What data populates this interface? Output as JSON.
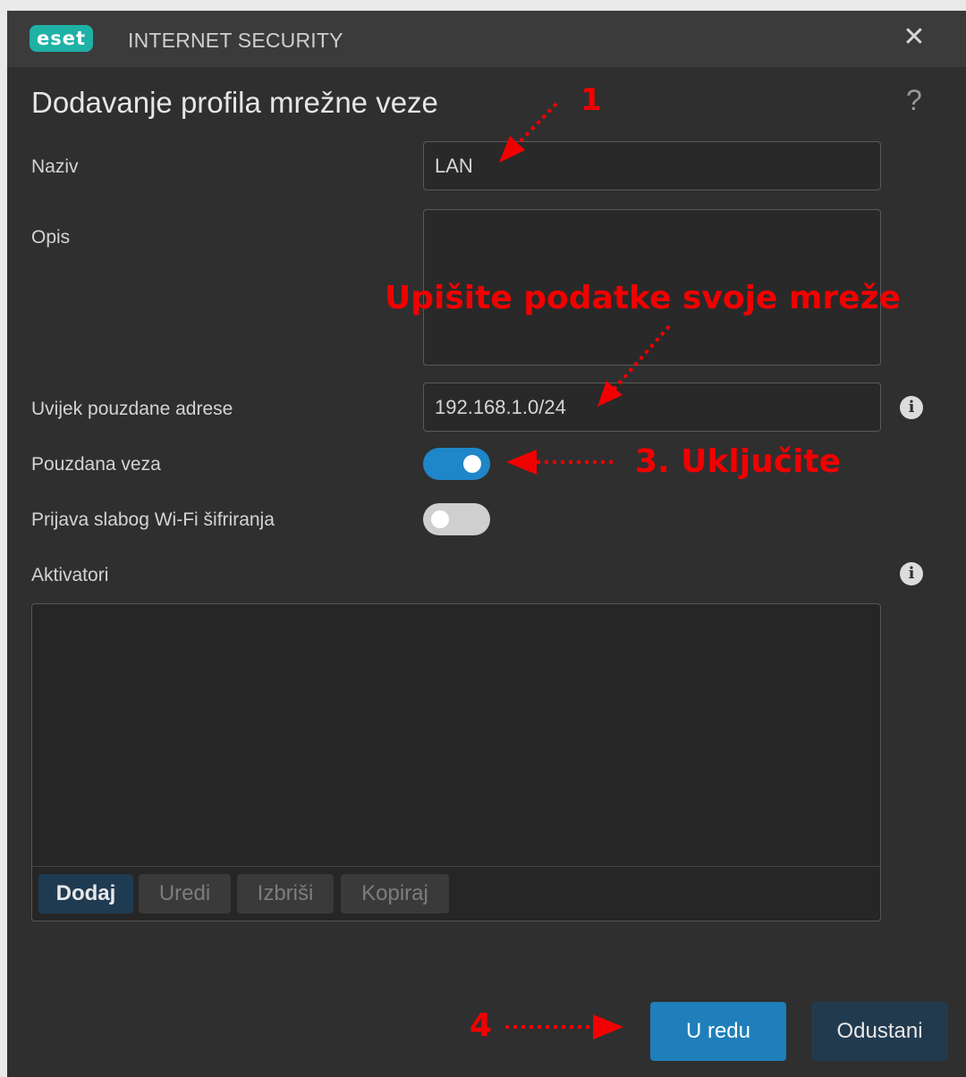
{
  "titlebar": {
    "logo": "eset",
    "product": "INTERNET SECURITY",
    "close_icon": "close-icon"
  },
  "dialog": {
    "title": "Dodavanje profila mrežne veze",
    "help_icon": "help-icon",
    "fields": {
      "name": {
        "label": "Naziv",
        "value": "LAN"
      },
      "description": {
        "label": "Opis",
        "value": ""
      },
      "trusted_addresses": {
        "label": "Uvijek pouzdane adrese",
        "value": "192.168.1.0/24",
        "info_icon": "info-icon"
      },
      "trusted_connection": {
        "label": "Pouzdana veza",
        "enabled": true
      },
      "weak_wifi": {
        "label": "Prijava slabog Wi-Fi šifriranja",
        "enabled": false
      }
    },
    "activators": {
      "label": "Aktivatori",
      "info_icon": "info-icon",
      "buttons": {
        "add": "Dodaj",
        "edit": "Uredi",
        "delete": "Izbriši",
        "copy": "Kopiraj"
      }
    },
    "ok_label": "U redu",
    "cancel_label": "Odustani"
  },
  "annotations": {
    "step1": "1",
    "step2": "Upišite podatke svoje mreže",
    "step3": "3. Uključite",
    "step4": "4"
  },
  "colors": {
    "toggle_on": "#1e86c9",
    "ok_button": "#1f7fba",
    "cancel_button": "#223a4e",
    "annotation_red": "#f20000",
    "brand_teal": "#1fb1a6"
  }
}
